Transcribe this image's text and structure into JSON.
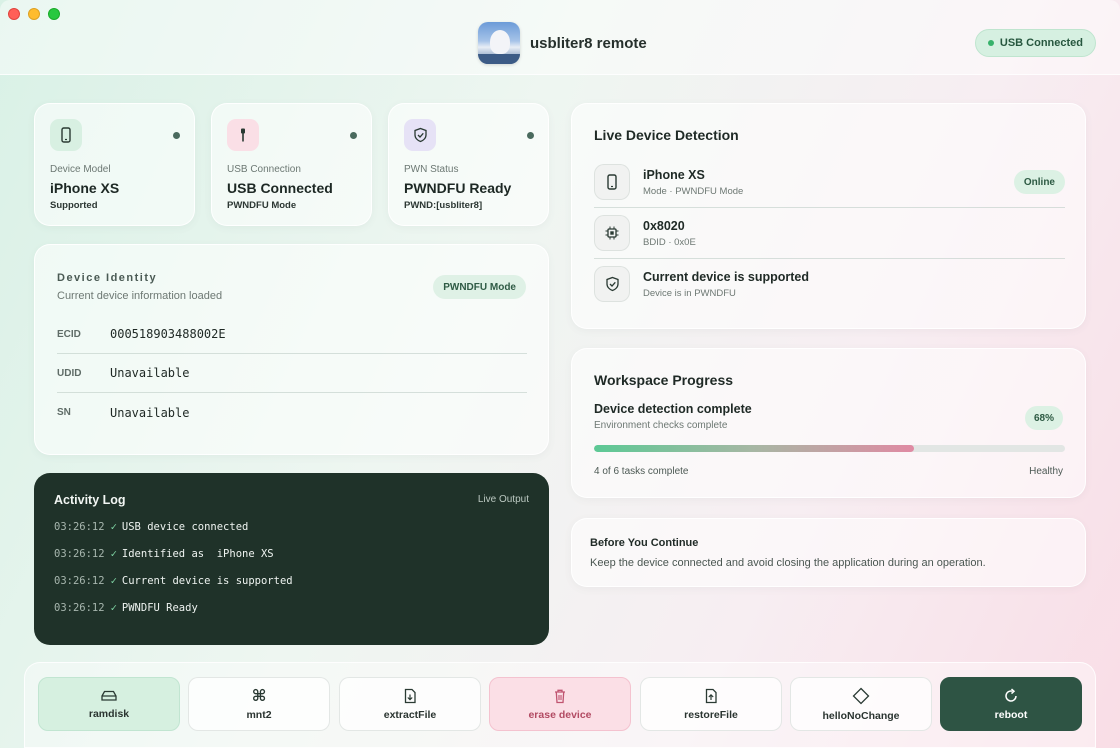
{
  "header": {
    "app_name": "usbliter8 remote",
    "usb_status": "USB Connected"
  },
  "stats": [
    {
      "label": "Device Model",
      "value": "iPhone XS",
      "sub": "Supported",
      "icon": "phone-icon"
    },
    {
      "label": "USB Connection",
      "value": "USB Connected",
      "sub": "PWNDFU Mode",
      "icon": "usb-plug-icon"
    },
    {
      "label": "PWN Status",
      "value": "PWNDFU Ready",
      "sub": "PWND:[usbliter8]",
      "icon": "shield-check-icon"
    }
  ],
  "identity": {
    "title": "Device Identity",
    "subtitle": "Current device information loaded",
    "mode_badge": "PWNDFU Mode",
    "rows": [
      {
        "key": "ECID",
        "value": "000518903488002E"
      },
      {
        "key": "UDID",
        "value": "Unavailable"
      },
      {
        "key": "SN",
        "value": "Unavailable"
      }
    ]
  },
  "activity_log": {
    "title": "Activity Log",
    "live_label": "Live Output",
    "entries": [
      {
        "time": "03:26:12",
        "message": "USB device connected"
      },
      {
        "time": "03:26:12",
        "message": "Identified as  iPhone XS"
      },
      {
        "time": "03:26:12",
        "message": "Current device is supported"
      },
      {
        "time": "03:26:12",
        "message": "PWNDFU Ready"
      }
    ]
  },
  "detection": {
    "title": "Live Device Detection",
    "rows": [
      {
        "title": "iPhone XS",
        "sub": "Mode · PWNDFU Mode",
        "badge": "Online",
        "icon": "phone-icon"
      },
      {
        "title": "0x8020",
        "sub": "BDID · 0x0E",
        "icon": "chip-icon"
      },
      {
        "title": "Current device is supported",
        "sub": "Device is in PWNDFU",
        "icon": "shield-check-icon"
      }
    ]
  },
  "progress": {
    "title": "Workspace Progress",
    "heading": "Device detection complete",
    "subtitle": "Environment checks complete",
    "percent_label": "68%",
    "percent": 68,
    "tasks_label": "4 of 6 tasks complete",
    "health": "Healthy"
  },
  "notice": {
    "title": "Before You Continue",
    "body": "Keep the device connected and avoid closing the application during an operation."
  },
  "toolbar": [
    {
      "label": "ramdisk",
      "icon": "drive-icon"
    },
    {
      "label": "mnt2",
      "icon": "command-icon"
    },
    {
      "label": "extractFile",
      "icon": "file-export-icon"
    },
    {
      "label": "erase device",
      "icon": "trash-icon"
    },
    {
      "label": "restoreFile",
      "icon": "file-upload-icon"
    },
    {
      "label": "helloNoChange",
      "icon": "diamond-icon"
    },
    {
      "label": "reboot",
      "icon": "refresh-icon"
    }
  ],
  "colors": {
    "accent_green": "#2e5454",
    "status_green": "#37b26b",
    "log_background": "#1f3229",
    "danger": "#b24b63"
  }
}
